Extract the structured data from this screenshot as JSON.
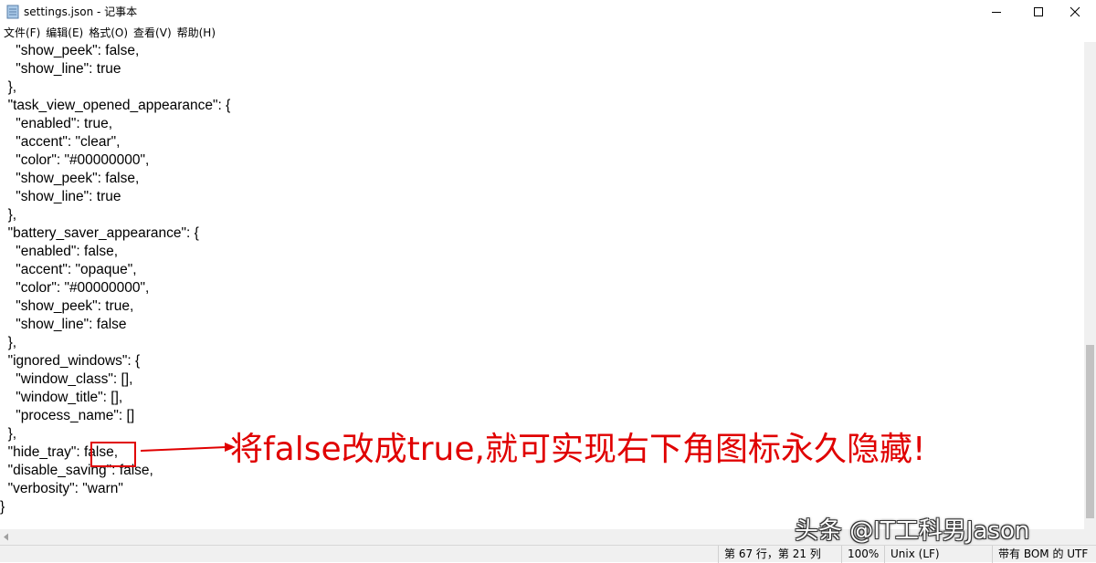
{
  "window": {
    "title": "settings.json - 记事本",
    "minimize_glyph": "—",
    "maximize_glyph": "☐",
    "close_glyph": "✕"
  },
  "menu": [
    "文件(F)",
    "编辑(E)",
    "格式(O)",
    "查看(V)",
    "帮助(H)"
  ],
  "editor": {
    "lines": [
      "    \"show_peek\": false,",
      "    \"show_line\": true",
      "  },",
      "  \"task_view_opened_appearance\": {",
      "    \"enabled\": true,",
      "    \"accent\": \"clear\",",
      "    \"color\": \"#00000000\",",
      "    \"show_peek\": false,",
      "    \"show_line\": true",
      "  },",
      "  \"battery_saver_appearance\": {",
      "    \"enabled\": false,",
      "    \"accent\": \"opaque\",",
      "    \"color\": \"#00000000\",",
      "    \"show_peek\": true,",
      "    \"show_line\": false",
      "  },",
      "  \"ignored_windows\": {",
      "    \"window_class\": [],",
      "    \"window_title\": [],",
      "    \"process_name\": []",
      "  },",
      "  \"hide_tray\": false,",
      "  \"disable_saving\": false,",
      "  \"verbosity\": \"warn\"",
      "}"
    ]
  },
  "annotation": {
    "text": "将false改成true,就可实现右下角图标永久隐藏!",
    "color": "#e00000"
  },
  "watermark": "头条 @IT工科男Jason",
  "statusbar": {
    "position": "第 67 行，第 21 列",
    "zoom": "100%",
    "line_ending": "Unix (LF)",
    "encoding": "带有 BOM 的 UTF"
  }
}
